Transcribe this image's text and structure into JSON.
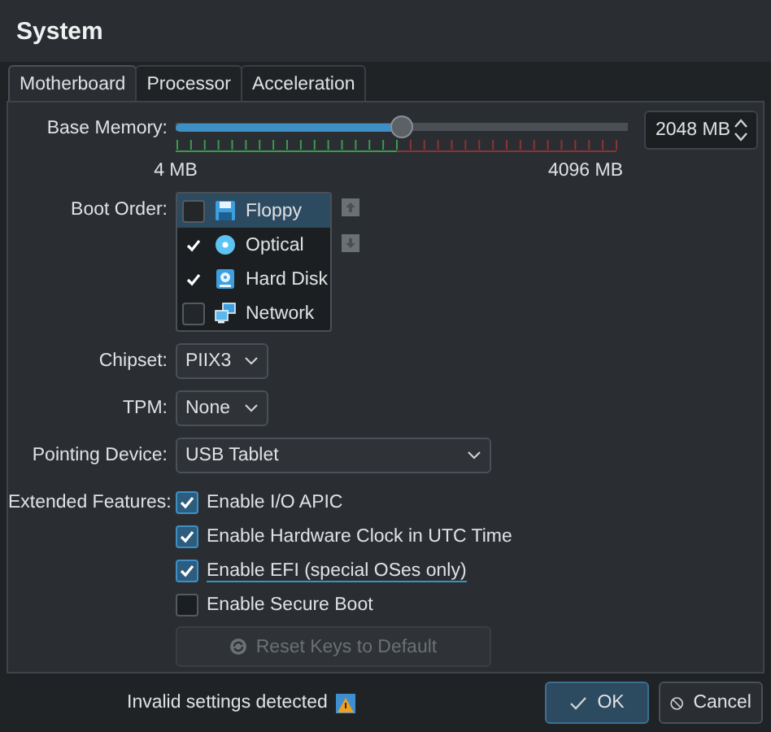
{
  "window": {
    "title": "System"
  },
  "tabs": [
    {
      "label": "Motherboard",
      "selected": true
    },
    {
      "label": "Processor",
      "selected": false
    },
    {
      "label": "Acceleration",
      "selected": false
    }
  ],
  "base_memory": {
    "label": "Base Memory:",
    "level": 0.5,
    "min_label": "4 MB",
    "max_label": "4096 MB",
    "value": "2048 MB"
  },
  "boot_order": {
    "label": "Boot Order:",
    "items": [
      {
        "label": "Floppy",
        "checked": false,
        "selected": true
      },
      {
        "label": "Optical",
        "checked": true,
        "selected": false
      },
      {
        "label": "Hard Disk",
        "checked": true,
        "selected": false
      },
      {
        "label": "Network",
        "checked": false,
        "selected": false
      }
    ]
  },
  "chipset": {
    "label": "Chipset:",
    "value": "PIIX3"
  },
  "tpm": {
    "label": "TPM:",
    "value": "None"
  },
  "pointing_device": {
    "label": "Pointing Device:",
    "value": "USB Tablet"
  },
  "extended_features": {
    "label": "Extended Features:",
    "items": [
      {
        "label": "Enable I/O APIC",
        "checked": true,
        "focused": false
      },
      {
        "label": "Enable Hardware Clock in UTC Time",
        "checked": true,
        "focused": false
      },
      {
        "label": "Enable EFI (special OSes only)",
        "checked": true,
        "focused": true
      },
      {
        "label": "Enable Secure Boot",
        "checked": false,
        "focused": false
      }
    ]
  },
  "reset_button": {
    "label": "Reset Keys to Default",
    "disabled": true
  },
  "status": "Invalid settings detected",
  "buttons": [
    {
      "label": "OK",
      "default": true
    },
    {
      "label": "Cancel",
      "default": false
    }
  ]
}
